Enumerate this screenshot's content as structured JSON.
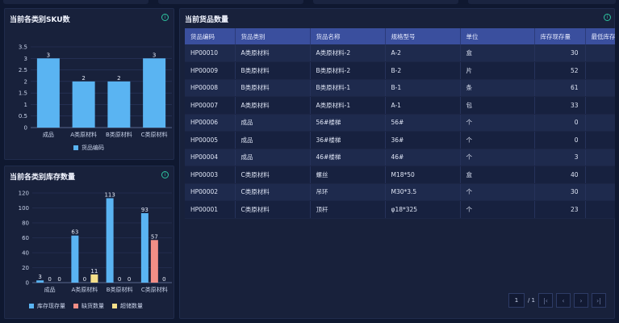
{
  "sku_panel": {
    "title": "当前各类别SKU数",
    "chart_data": {
      "type": "bar",
      "categories": [
        "成品",
        "A类原材料",
        "B类原材料",
        "C类原材料"
      ],
      "series": [
        {
          "name": "货品编码",
          "values": [
            3,
            2,
            2,
            3
          ]
        }
      ],
      "ylim": [
        0,
        3.5
      ],
      "yticks": [
        "0",
        "0.5",
        "1",
        "1.5",
        "2",
        "2.5",
        "3",
        "3.5"
      ],
      "grid": true,
      "legend": "bottom",
      "colors": [
        "#5ab4f2"
      ]
    }
  },
  "stock_panel": {
    "title": "当前各类别库存数量",
    "chart_data": {
      "type": "bar",
      "categories": [
        "成品",
        "A类原材料",
        "B类原材料",
        "C类原材料"
      ],
      "series": [
        {
          "name": "库存现存量",
          "values": [
            3,
            63,
            113,
            93
          ]
        },
        {
          "name": "缺货数量",
          "values": [
            0,
            0,
            0,
            57
          ]
        },
        {
          "name": "超储数量",
          "values": [
            0,
            11,
            0,
            0
          ]
        }
      ],
      "ylim": [
        0,
        120
      ],
      "yticks": [
        "0",
        "20",
        "40",
        "60",
        "80",
        "100",
        "120"
      ],
      "grid": true,
      "legend": "bottom",
      "colors": [
        "#5ab4f2",
        "#f28e86",
        "#f5e08a"
      ]
    }
  },
  "goods_panel": {
    "title": "当前货品数量",
    "columns": [
      "货品编码",
      "货品类别",
      "货品名称",
      "规格型号",
      "单位",
      "库存现存量",
      "最低库存量"
    ],
    "rows": [
      [
        "HP00010",
        "A类原材料",
        "A类原材料-2",
        "A-2",
        "盒",
        "30",
        ""
      ],
      [
        "HP00009",
        "B类原材料",
        "B类原材料-2",
        "B-2",
        "片",
        "52",
        ""
      ],
      [
        "HP00008",
        "B类原材料",
        "B类原材料-1",
        "B-1",
        "条",
        "61",
        ""
      ],
      [
        "HP00007",
        "A类原材料",
        "A类原材料-1",
        "A-1",
        "包",
        "33",
        ""
      ],
      [
        "HP00006",
        "成品",
        "56#楼梯",
        "56#",
        "个",
        "0",
        ""
      ],
      [
        "HP00005",
        "成品",
        "36#楼梯",
        "36#",
        "个",
        "0",
        ""
      ],
      [
        "HP00004",
        "成品",
        "46#楼梯",
        "46#",
        "个",
        "3",
        ""
      ],
      [
        "HP00003",
        "C类原材料",
        "螺丝",
        "M18*50",
        "盒",
        "40",
        ""
      ],
      [
        "HP00002",
        "C类原材料",
        "吊环",
        "M30*3.5",
        "个",
        "30",
        ""
      ],
      [
        "HP00001",
        "C类原材料",
        "顶杆",
        "φ18*325",
        "个",
        "23",
        ""
      ]
    ],
    "pager": {
      "page": "1",
      "total": "/ 1"
    }
  }
}
